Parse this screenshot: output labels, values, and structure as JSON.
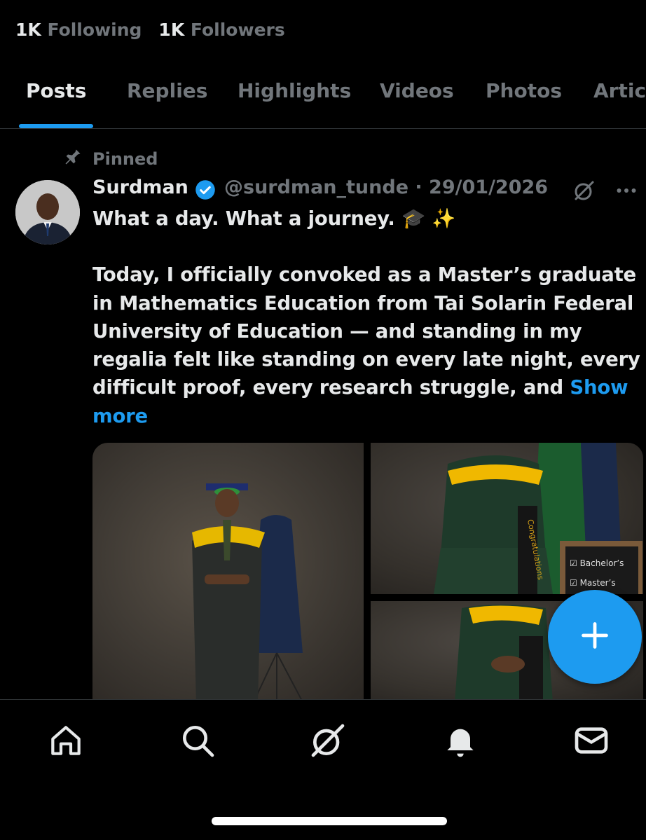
{
  "profile": {
    "following_count": "1K",
    "following_label": "Following",
    "followers_count": "1K",
    "followers_label": "Followers"
  },
  "tabs": [
    {
      "label": "Posts",
      "active": true
    },
    {
      "label": "Replies",
      "active": false
    },
    {
      "label": "Highlights",
      "active": false
    },
    {
      "label": "Videos",
      "active": false
    },
    {
      "label": "Photos",
      "active": false
    },
    {
      "label": "Artic",
      "active": false
    }
  ],
  "post": {
    "pinned_label": "Pinned",
    "author_name": "Surdman",
    "handle_date": "@surdman_tunde · 29/01/2026",
    "text_lines": [
      "What a day. What a journey. 🎓 ✨",
      "",
      "Today, I officially convoked as a Master’s graduate",
      "in Mathematics Education from Tai Solarin Federal",
      "University of Education — and standing in my",
      "regalia felt like standing on every late night, every",
      "difficult proof, every research struggle, and "
    ],
    "show_more_1": "Show",
    "show_more_2": "more",
    "media": {
      "sash_text": "Congratulations",
      "board_line_1": "☑ Bachelor’s",
      "board_line_2": "☑ Master’s"
    }
  },
  "colors": {
    "accent": "#1d9bf0",
    "muted": "#71767b",
    "text": "#e7e9ea",
    "background": "#000000"
  },
  "icons": {
    "pin": "pin-icon",
    "verified": "verified-badge-icon",
    "grok": "grok-icon",
    "more": "more-icon",
    "compose": "plus-icon",
    "nav": [
      "home-icon",
      "search-icon",
      "grok-icon",
      "bell-icon",
      "mail-icon"
    ]
  }
}
